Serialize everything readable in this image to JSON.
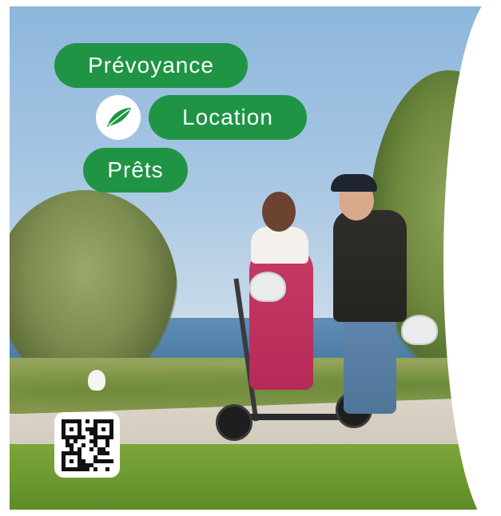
{
  "tags": {
    "prevoyance": "Prévoyance",
    "location": "Location",
    "prets": "Prêts"
  },
  "colors": {
    "brand_green": "#1f9445",
    "tag_text": "#ffffff"
  },
  "icons": {
    "logo": "green-leaf-logo-icon",
    "qr": "qr-code-icon"
  }
}
